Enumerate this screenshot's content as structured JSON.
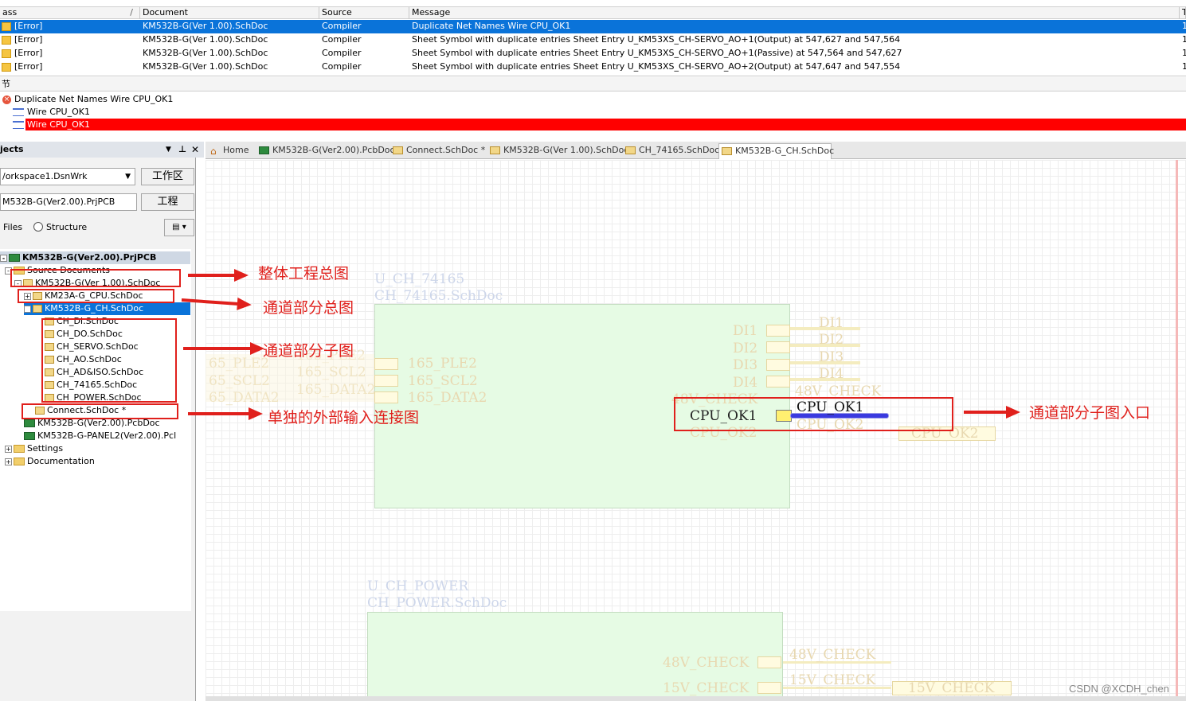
{
  "messages": {
    "columns": [
      "ass",
      "Document",
      "Source",
      "Message",
      "T"
    ],
    "rows": [
      {
        "class": "[Error]",
        "document": "KM532B-G(Ver 1.00).SchDoc",
        "source": "Compiler",
        "message": "Duplicate Net Names Wire CPU_OK1",
        "t": "1",
        "selected": true
      },
      {
        "class": "[Error]",
        "document": "KM532B-G(Ver 1.00).SchDoc",
        "source": "Compiler",
        "message": "Sheet Symbol with duplicate entries Sheet Entry U_KM53XS_CH-SERVO_AO+1(Output) at 547,627 and 547,564",
        "t": "1",
        "selected": false
      },
      {
        "class": "[Error]",
        "document": "KM532B-G(Ver 1.00).SchDoc",
        "source": "Compiler",
        "message": "Sheet Symbol with duplicate entries Sheet Entry U_KM53XS_CH-SERVO_AO+1(Passive) at 547,564 and 547,627",
        "t": "1",
        "selected": false
      },
      {
        "class": "[Error]",
        "document": "KM532B-G(Ver 1.00).SchDoc",
        "source": "Compiler",
        "message": "Sheet Symbol with duplicate entries Sheet Entry U_KM53XS_CH-SERVO_AO+2(Output) at 547,647 and 547,554",
        "t": "1",
        "selected": false
      }
    ]
  },
  "details": {
    "title": "节",
    "error": "Duplicate Net Names Wire CPU_OK1",
    "wire1": "Wire CPU_OK1",
    "wire2": "Wire CPU_OK1"
  },
  "projects_panel": {
    "title": "jects",
    "workspace": "/orkspace1.DsnWrk",
    "workspace_btn": "工作区",
    "project": "M532B-G(Ver2.00).PrjPCB",
    "project_btn": "工程",
    "files_label": "Files",
    "structure_label": "Structure",
    "tree": {
      "project": "KM532B-G(Ver2.00).PrjPCB",
      "source_docs": "Source Documents",
      "main_sch": "KM532B-G(Ver 1.00).SchDoc",
      "cpu_sch": "KM23A-G_CPU.SchDoc",
      "ch_sch": "KM532B-G_CH.SchDoc",
      "children": [
        "CH_DI.SchDoc",
        "CH_DO.SchDoc",
        "CH_SERVO.SchDoc",
        "CH_AO.SchDoc",
        "CH_AD&ISO.SchDoc",
        "CH_74165.SchDoc",
        "CH_POWER.SchDoc"
      ],
      "connect": "Connect.SchDoc *",
      "pcb1": "KM532B-G(Ver2.00).PcbDoc",
      "pcb2": "KM532B-G-PANEL2(Ver2.00).Pcl",
      "settings": "Settings",
      "documentation": "Documentation"
    }
  },
  "annotations": {
    "overall": "整体工程总图",
    "channel_total": "通道部分总图",
    "channel_sub": "通道部分子图",
    "external": "单独的外部输入连接图",
    "entry": "通道部分子图入口"
  },
  "tabs": [
    {
      "label": "Home"
    },
    {
      "label": "KM532B-G(Ver2.00).PcbDoc"
    },
    {
      "label": "Connect.SchDoc *"
    },
    {
      "label": "KM532B-G(Ver 1.00).SchDoc"
    },
    {
      "label": "CH_74165.SchDoc"
    },
    {
      "label": "KM532B-G_CH.SchDoc",
      "active": true
    }
  ],
  "schematic": {
    "sheet1_designator": "U_CH_74165",
    "sheet1_file": "CH_74165.SchDoc",
    "sheet1_entries_left": [
      "165_PLE2",
      "165_SCL2",
      "165_DATA2"
    ],
    "left_nets": [
      "65_PLE2",
      "65_SCL2",
      "65_DATA2"
    ],
    "left_faint": [
      "165_PLE2",
      "165_SCL2",
      "165_DATA2"
    ],
    "sheet1_entries_right": [
      "DI1",
      "DI2",
      "DI3",
      "DI4",
      "48V_CHECK",
      "CPU_OK1",
      "CPU_OK2"
    ],
    "right_nets": [
      "DI1",
      "DI2",
      "DI3",
      "DI4",
      "48V_CHECK",
      "CPU_OK1",
      "CPU_OK2"
    ],
    "port_cpu_ok2": "CPU_OK2",
    "sheet2_designator": "U_CH_POWER",
    "sheet2_file": "CH_POWER.SchDoc",
    "sheet2_entries": [
      "48V_CHECK",
      "15V_CHECK"
    ],
    "sheet2_nets": [
      "48V_CHECK",
      "15V_CHECK"
    ],
    "port_15v": "15V_CHECK"
  },
  "watermark": "CSDN @XCDH_chen",
  "colors": {
    "selection": "#0a73d9",
    "highlight_red": "#ff0000",
    "annotation": "#e0201c",
    "sheet_fill": "#e6fbe4"
  }
}
